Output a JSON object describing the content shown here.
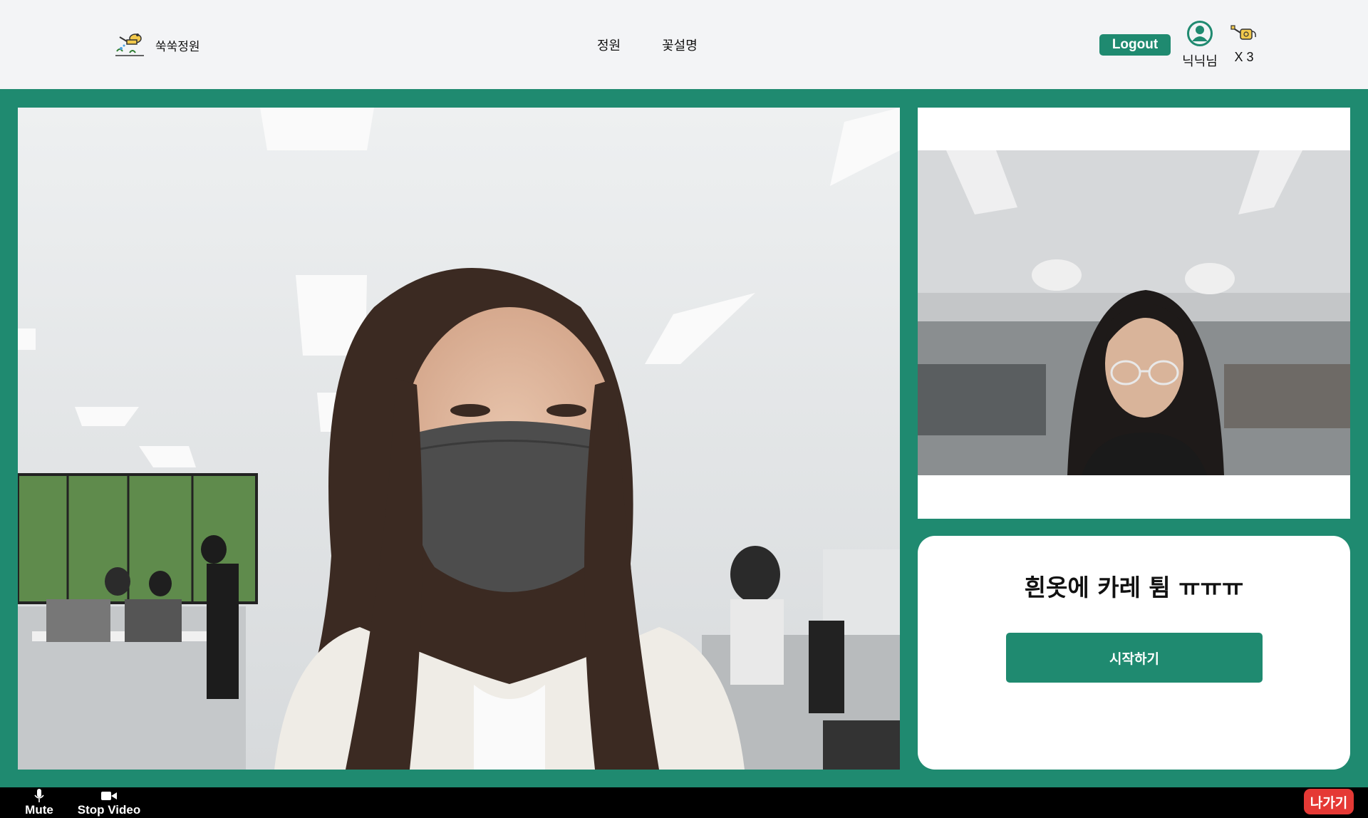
{
  "header": {
    "brand_name": "쑥쑥정원",
    "nav": [
      {
        "label": "정원"
      },
      {
        "label": "꽃설명"
      }
    ],
    "logout_label": "Logout",
    "user_name": "닉닉님",
    "watering_can_count": "X 3"
  },
  "session": {
    "topic": "흰옷에 카레 튐 ㅠㅠㅠ",
    "start_label": "시작하기"
  },
  "controls": {
    "mute_label": "Mute",
    "stop_video_label": "Stop Video",
    "leave_label": "나가기"
  },
  "colors": {
    "accent": "#1f8a70",
    "leave": "#e53935",
    "bar": "#000000",
    "header_bg": "#f3f4f6"
  },
  "icons": {
    "brand": "watering-can-logo-icon",
    "avatar": "user-circle-icon",
    "can": "watering-can-icon",
    "mute": "microphone-icon",
    "stop_video": "video-camera-icon"
  }
}
